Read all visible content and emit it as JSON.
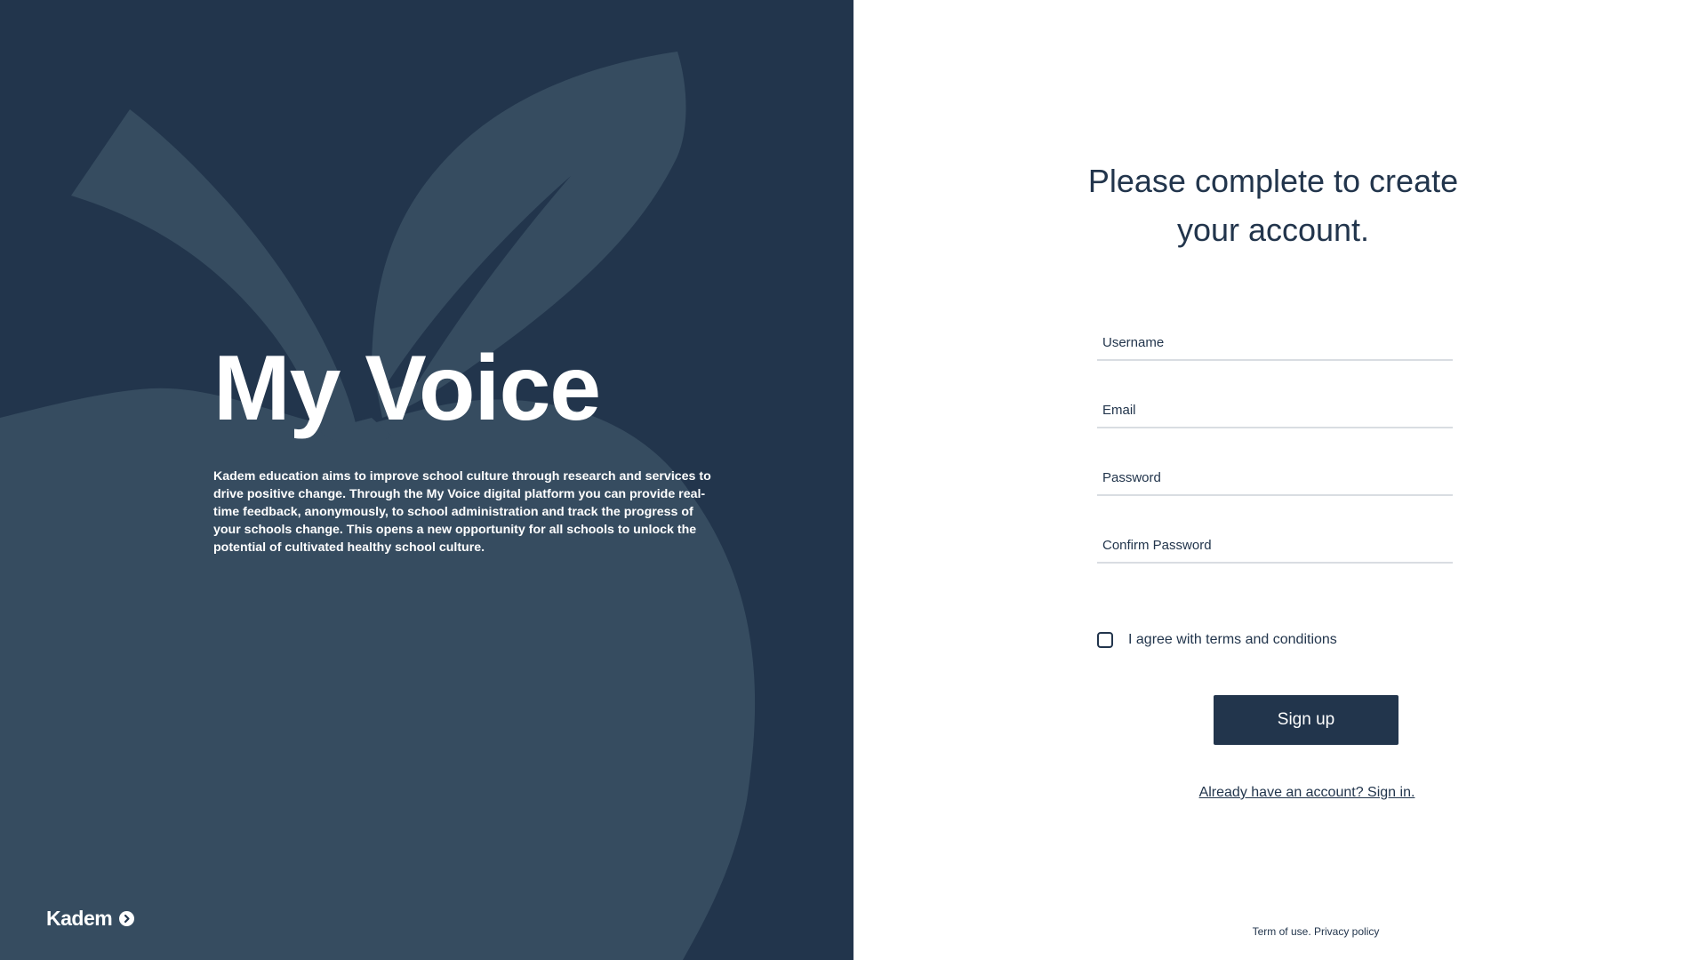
{
  "colors": {
    "navy": "#22354c",
    "apple": "#364c60",
    "white": "#ffffff",
    "field_line": "#d9dde2"
  },
  "hero": {
    "title": "My Voice",
    "description": "Kadem education aims to improve school culture through research and services to drive positive change.  Through the My Voice digital platform you can provide real-time feedback, anonymously, to school administration and track the progress of your schools change.  This opens a new opportunity for all schools to unlock the potential of cultivated healthy school culture."
  },
  "brand": {
    "name": "Kadem",
    "icon": "chevron-right-circle-icon"
  },
  "form": {
    "heading": "Please complete to create your account.",
    "fields": {
      "username": {
        "placeholder": "Username",
        "value": ""
      },
      "email": {
        "placeholder": "Email",
        "value": ""
      },
      "password": {
        "placeholder": "Password",
        "value": ""
      },
      "confirm_password": {
        "placeholder": "Confirm Password",
        "value": ""
      }
    },
    "agree_label": "I agree with terms and conditions",
    "agree_checked": false,
    "submit_label": "Sign up",
    "signin_link": "Already have an account? Sign in."
  },
  "footer": {
    "terms": "Term of use.",
    "privacy": "Privacy policy"
  }
}
